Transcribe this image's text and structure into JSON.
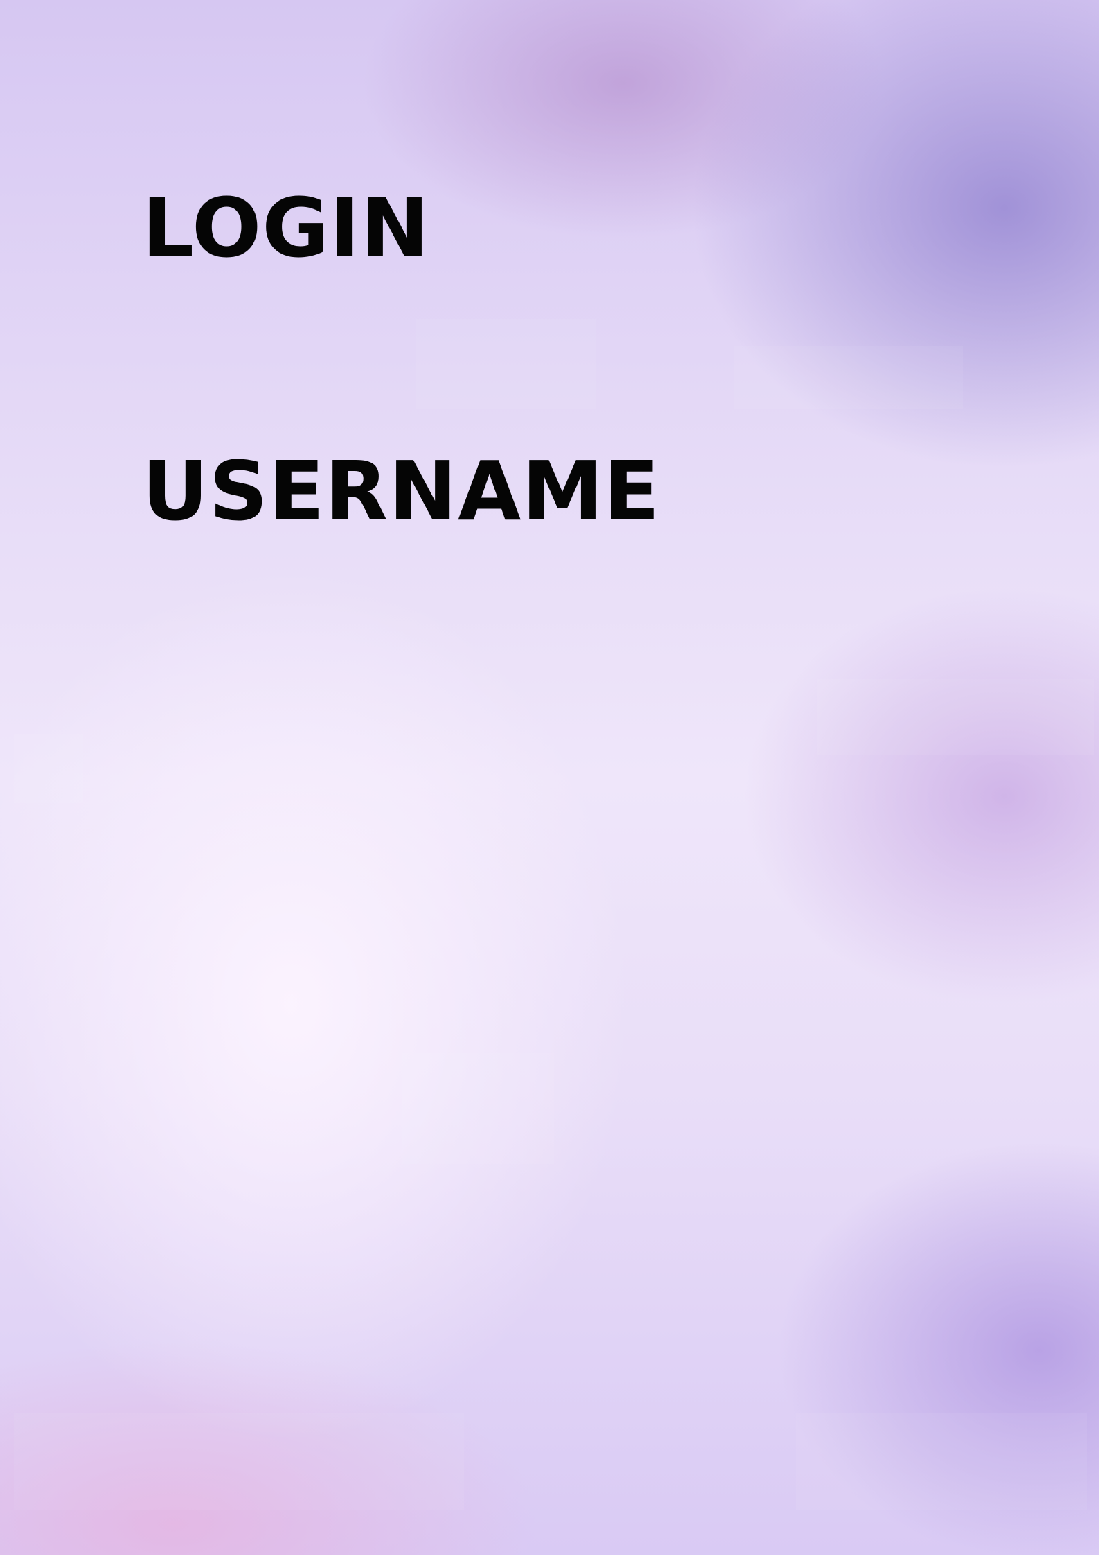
{
  "login": {
    "title": "LOGIN",
    "username_label": "USERNAME"
  },
  "colors": {
    "text": "#050505",
    "background_light": "#efe6fa",
    "background_accent": "#9687d2"
  }
}
